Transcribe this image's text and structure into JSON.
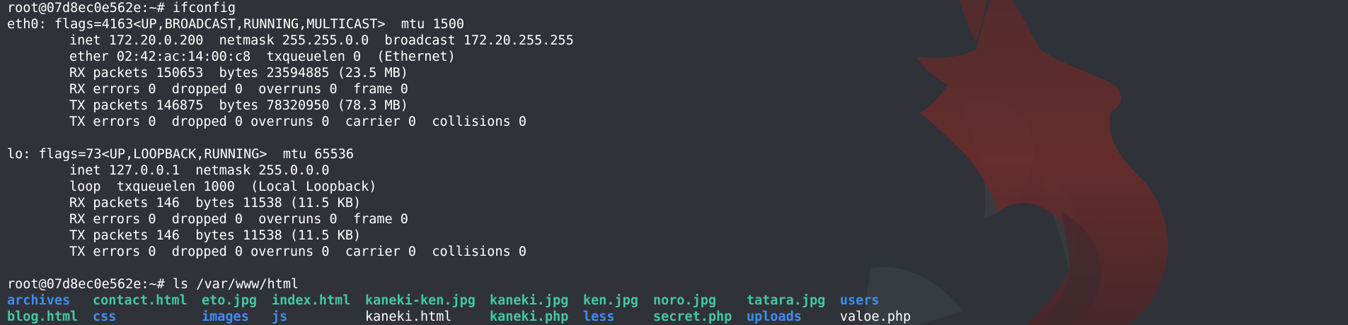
{
  "colors": {
    "background": "#2f3238",
    "text": "#ffffff",
    "directory": "#3e8ef5",
    "image_file": "#41c9a4",
    "regular_file": "#ffffff",
    "wallpaper_figure": "#6b2a2a"
  },
  "wallpaper": {
    "icon": "kali-dragon-silhouette-icon"
  },
  "terminal": {
    "lines": [
      "root@07d8ec0e562e:~# ifconfig",
      "eth0: flags=4163<UP,BROADCAST,RUNNING,MULTICAST>  mtu 1500",
      "inet 172.20.0.200  netmask 255.255.0.0  broadcast 172.20.255.255",
      "ether 02:42:ac:14:00:c8  txqueuelen 0  (Ethernet)",
      "RX packets 150653  bytes 23594885 (23.5 MB)",
      "RX errors 0  dropped 0  overruns 0  frame 0",
      "TX packets 146875  bytes 78320950 (78.3 MB)",
      "TX errors 0  dropped 0 overruns 0  carrier 0  collisions 0",
      "",
      "lo: flags=73<UP,LOOPBACK,RUNNING>  mtu 65536",
      "inet 127.0.0.1  netmask 255.0.0.0",
      "loop  txqueuelen 1000  (Local Loopback)",
      "RX packets 146  bytes 11538 (11.5 KB)",
      "RX errors 0  dropped 0  overruns 0  frame 0",
      "TX packets 146  bytes 11538 (11.5 KB)",
      "TX errors 0  dropped 0 overruns 0  carrier 0  collisions 0",
      "",
      "root@07d8ec0e562e:~# ls /var/www/html"
    ],
    "ls_output": {
      "row1": [
        {
          "name": "archives",
          "type": "dir"
        },
        {
          "name": "contact.html",
          "type": "img"
        },
        {
          "name": "eto.jpg",
          "type": "img"
        },
        {
          "name": "index.html",
          "type": "img"
        },
        {
          "name": "kaneki-ken.jpg",
          "type": "img"
        },
        {
          "name": "kaneki.jpg",
          "type": "img"
        },
        {
          "name": "ken.jpg",
          "type": "img"
        },
        {
          "name": "noro.jpg",
          "type": "img"
        },
        {
          "name": "tatara.jpg",
          "type": "img"
        },
        {
          "name": "users",
          "type": "dir"
        }
      ],
      "row2": [
        {
          "name": "blog.html",
          "type": "img"
        },
        {
          "name": "css",
          "type": "dir"
        },
        {
          "name": "images",
          "type": "dir"
        },
        {
          "name": "js",
          "type": "dir"
        },
        {
          "name": "kaneki.html",
          "type": "file"
        },
        {
          "name": "kaneki.php",
          "type": "img"
        },
        {
          "name": "less",
          "type": "dir"
        },
        {
          "name": "secret.php",
          "type": "img"
        },
        {
          "name": "uploads",
          "type": "dir"
        },
        {
          "name": "valoe.php",
          "type": "file"
        }
      ]
    }
  }
}
